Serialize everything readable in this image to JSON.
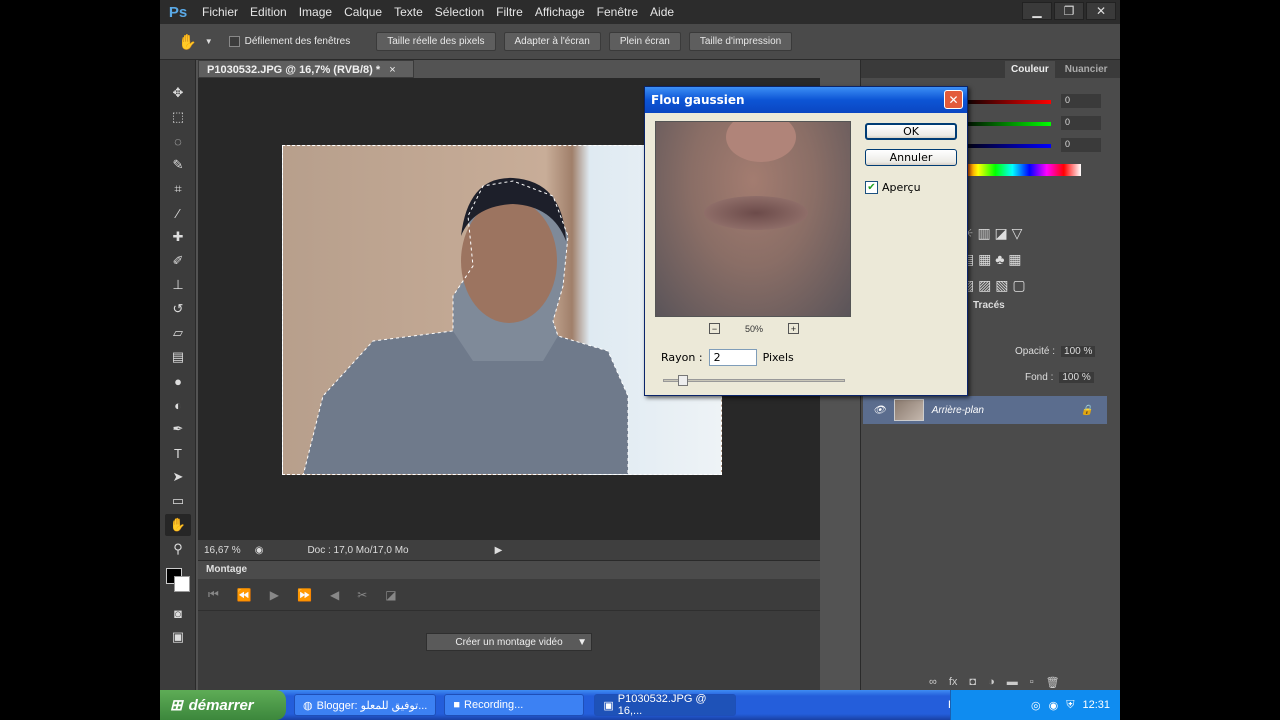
{
  "app": {
    "logo": "Ps",
    "menu": [
      "Fichier",
      "Edition",
      "Image",
      "Calque",
      "Texte",
      "Sélection",
      "Filtre",
      "Affichage",
      "Fenêtre",
      "Aide"
    ]
  },
  "options": {
    "scroll_all": "Défilement des fenêtres",
    "actual_pixels": "Taille réelle des pixels",
    "fit_screen": "Adapter à l'écran",
    "full_screen": "Plein écran",
    "print_size": "Taille d'impression"
  },
  "document": {
    "tab": "P1030532.JPG @ 16,7% (RVB/8) *",
    "zoom": "16,67 %",
    "doc_info": "Doc : 17,0 Mo/17,0 Mo"
  },
  "montage": {
    "title": "Montage",
    "create_button": "Créer un montage vidéo"
  },
  "panels": {
    "color_tab": "Couleur",
    "swatches_tab": "Nuancier",
    "rgb_values": [
      "0",
      "0",
      "0"
    ],
    "paths_tab": "Tracés",
    "opacity_label": "Opacité :",
    "opacity_value": "100 %",
    "fill_label": "Fond :",
    "fill_value": "100 %",
    "layer_name": "Arrière-plan"
  },
  "dialog": {
    "title": "Flou gaussien",
    "ok": "OK",
    "cancel": "Annuler",
    "preview_label": "Aperçu",
    "zoom": "50%",
    "radius_label": "Rayon :",
    "radius_value": "2",
    "radius_unit": "Pixels"
  },
  "taskbar": {
    "start": "démarrer",
    "tasks": [
      "Blogger: توفيق للمعلو...",
      "Recording...",
      "P1030532.JPG @ 16,..."
    ],
    "lang": "FR",
    "clock": "12:31"
  },
  "colors": {
    "dialog_titlebar": "#0d55d5",
    "layer_selected": "#5b6d8e",
    "taskbar": "#245edb"
  }
}
